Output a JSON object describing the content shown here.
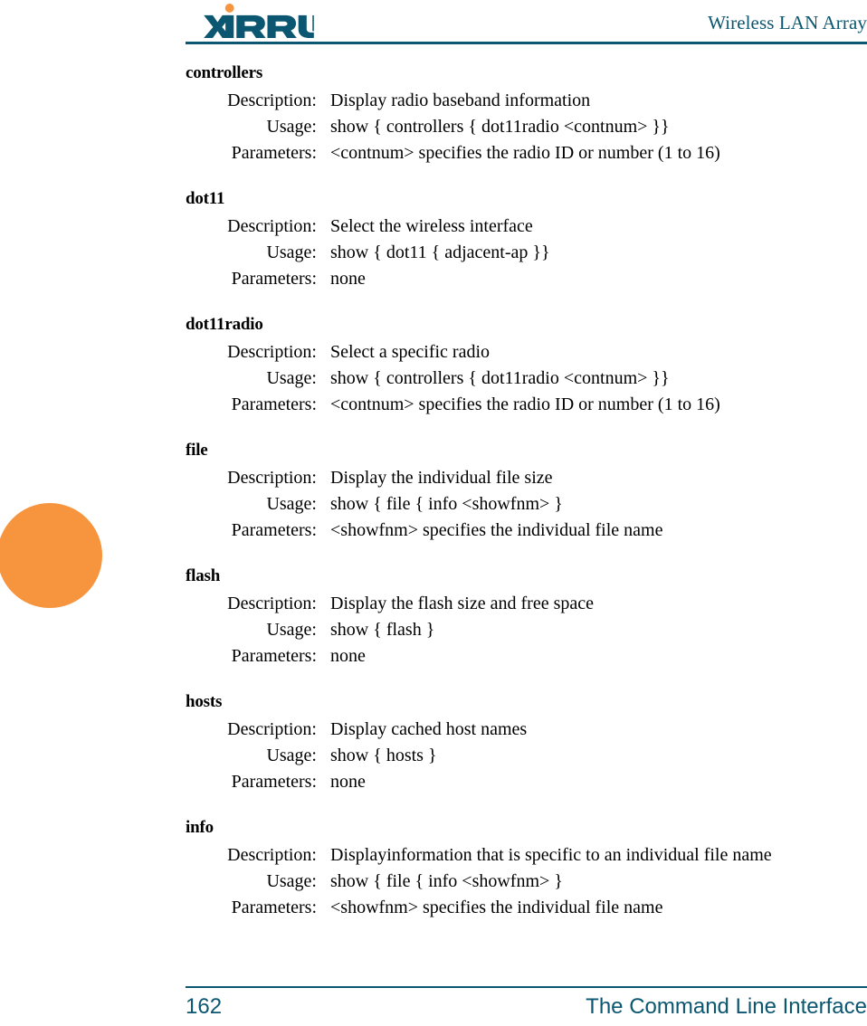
{
  "colors": {
    "brand_teal": "#0b5670",
    "brand_orange": "#f7953e",
    "text": "#000000",
    "page_background": "#ffffff"
  },
  "header": {
    "logo_text": "XIRRUS",
    "logo_icon": "xirrus-logo",
    "title": "Wireless LAN Array"
  },
  "decoration": {
    "margin_circle": "orange-circle"
  },
  "labels": {
    "description": "Description:",
    "usage": "Usage:",
    "parameters": "Parameters:"
  },
  "sections": [
    {
      "name": "controllers",
      "description": "Display radio baseband information",
      "usage": "show { controllers { dot11radio <contnum> }}",
      "parameters": "<contnum> specifies the radio ID or number (1 to 16)"
    },
    {
      "name": "dot11",
      "description": "Select the wireless interface",
      "usage": "show { dot11 { adjacent-ap }}",
      "parameters": "none"
    },
    {
      "name": "dot11radio",
      "description": "Select a specific radio",
      "usage": "show { controllers { dot11radio <contnum> }}",
      "parameters": "<contnum> specifies the radio ID or number (1 to 16)"
    },
    {
      "name": "file",
      "description": "Display the individual file size",
      "usage": "show { file { info <showfnm> }",
      "parameters": "<showfnm> specifies the individual file name"
    },
    {
      "name": "flash",
      "description": "Display the flash size and free space",
      "usage": "show { flash }",
      "parameters": "none"
    },
    {
      "name": "hosts",
      "description": "Display cached host names",
      "usage": "show { hosts }",
      "parameters": "none"
    },
    {
      "name": "info",
      "description": "Displayinformation that is specific to an individual file name",
      "usage": "show { file { info <showfnm> }",
      "parameters": "<showfnm> specifies the individual file name"
    }
  ],
  "footer": {
    "page_number": "162",
    "chapter_title": "The Command Line Interface"
  }
}
